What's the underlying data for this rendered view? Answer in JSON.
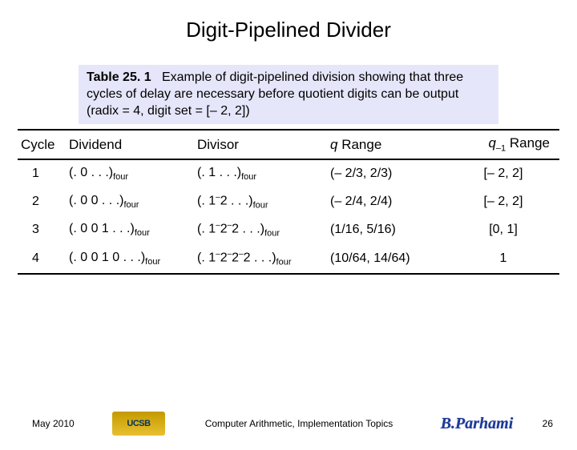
{
  "title": "Digit-Pipelined Divider",
  "caption": {
    "table_label": "Table 25. 1",
    "text": "Example of digit-pipelined division showing that three cycles of delay are necessary before quotient digits can be output (radix = 4, digit set = [– 2, 2])"
  },
  "headers": {
    "cycle": "Cycle",
    "dividend": "Dividend",
    "divisor": "Divisor",
    "q_range_prefix": "q",
    "q_range_suffix": " Range",
    "q1_range_prefix": "q",
    "q1_sub": "–1",
    "q1_range_suffix": " Range"
  },
  "rows": [
    {
      "cycle": "1",
      "dividend_main": "(. 0 . . .)",
      "dividend_sub": "four",
      "divisor_main": "(. 1 . . .)",
      "divisor_sub": "four",
      "q_range": "(– 2/3, 2/3)",
      "q1_range": "[– 2, 2]"
    },
    {
      "cycle": "2",
      "dividend_main": "(. 0 0 . . .)",
      "dividend_sub": "four",
      "divisor_pre": "(. 1",
      "divisor_sup": "–",
      "divisor_post": "2 . . .)",
      "divisor_sub": "four",
      "q_range": "(– 2/4, 2/4)",
      "q1_range": "[– 2, 2]"
    },
    {
      "cycle": "3",
      "dividend_main": "(. 0 0 1 . . .)",
      "dividend_sub": "four",
      "divisor_pre": "(. 1",
      "divisor_sup": "–",
      "divisor_mid": "2",
      "divisor_sup2": "–",
      "divisor_post": "2 . . .)",
      "divisor_sub": "four",
      "q_range": "(1/16, 5/16)",
      "q1_range": "[0, 1]"
    },
    {
      "cycle": "4",
      "dividend_main": "(. 0 0 1 0 . . .)",
      "dividend_sub": "four",
      "divisor_pre": "(. 1",
      "divisor_sup": "–",
      "divisor_mid1": "2",
      "divisor_sup2": "–",
      "divisor_mid2": "2",
      "divisor_sup3": "–",
      "divisor_post": "2 . . .)",
      "divisor_sub": "four",
      "q_range": "(10/64, 14/64)",
      "q1_range": "1"
    }
  ],
  "footer": {
    "date": "May 2010",
    "logo_text": "UCSB",
    "center": "Computer Arithmetic, Implementation Topics",
    "signature": "B.Parhami",
    "page": "26"
  }
}
